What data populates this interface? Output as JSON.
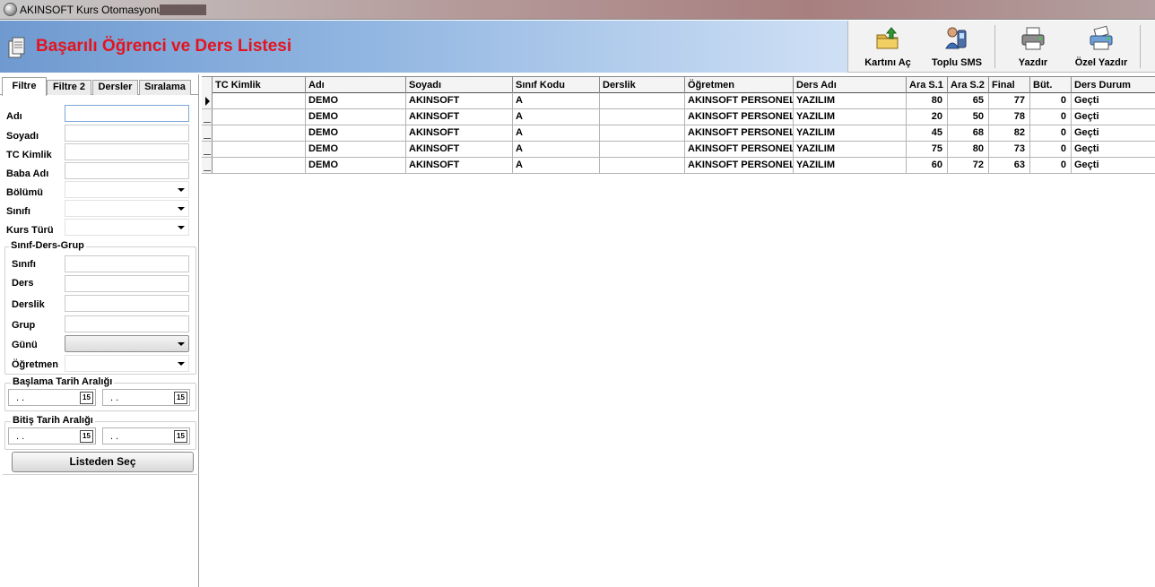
{
  "window": {
    "title": "AKINSOFT Kurs Otomasyonu s"
  },
  "header": {
    "title": "Başarılı Öğrenci ve Ders Listesi"
  },
  "toolbar": {
    "buttons": [
      {
        "label": "Kartını Aç",
        "icon": "folder-up-icon"
      },
      {
        "label": "Toplu SMS",
        "icon": "mobile-phone-user-icon"
      },
      {
        "label": "Yazdır",
        "icon": "printer-icon"
      },
      {
        "label": "Özel Yazdır",
        "icon": "custom-printer-icon"
      }
    ]
  },
  "filter": {
    "tabs": [
      "Filtre",
      "Filtre 2",
      "Dersler",
      "Sıralama"
    ],
    "labels": {
      "adi": "Adı",
      "soyadi": "Soyadı",
      "tc": "TC Kimlik",
      "baba": "Baba Adı",
      "bolumu": "Bölümü",
      "sinifi": "Sınıfı",
      "kurs_turu": "Kurs Türü"
    },
    "group_sdg": {
      "title": "Sınıf-Ders-Grup",
      "sinifi": "Sınıfı",
      "ders": "Ders",
      "derslik": "Derslik",
      "grup": "Grup",
      "gunu": "Günü",
      "ogretmen": "Öğretmen"
    },
    "baslama": {
      "title": "Başlama Tarih Aralığı",
      "from": ". .",
      "to": ". .",
      "cal": "15"
    },
    "bitis": {
      "title": "Bitiş Tarih Aralığı",
      "from": ". .",
      "to": ". .",
      "cal": "15"
    },
    "pick_button": "Listeden Seç"
  },
  "grid": {
    "columns": [
      "TC Kimlik",
      "Adı",
      "Soyadı",
      "Sınıf Kodu",
      "Derslik",
      "Öğretmen",
      "Ders Adı",
      "Ara S.1",
      "Ara S.2",
      "Final",
      "Büt.",
      "Ders Durum"
    ],
    "rows": [
      [
        "",
        "DEMO",
        "AKINSOFT",
        "A",
        "",
        "AKINSOFT PERSONEL",
        "YAZILIM",
        "80",
        "65",
        "77",
        "0",
        "Geçti"
      ],
      [
        "",
        "DEMO",
        "AKINSOFT",
        "A",
        "",
        "AKINSOFT PERSONEL",
        "YAZILIM",
        "20",
        "50",
        "78",
        "0",
        "Geçti"
      ],
      [
        "",
        "DEMO",
        "AKINSOFT",
        "A",
        "",
        "AKINSOFT PERSONEL",
        "YAZILIM",
        "45",
        "68",
        "82",
        "0",
        "Geçti"
      ],
      [
        "",
        "DEMO",
        "AKINSOFT",
        "A",
        "",
        "AKINSOFT PERSONEL",
        "YAZILIM",
        "75",
        "80",
        "73",
        "0",
        "Geçti"
      ],
      [
        "",
        "DEMO",
        "AKINSOFT",
        "A",
        "",
        "AKINSOFT PERSONEL",
        "YAZILIM",
        "60",
        "72",
        "63",
        "0",
        "Geçti"
      ]
    ]
  },
  "colors": {
    "title_red": "#e4141e",
    "banner_blue": "#6f9ad0"
  }
}
